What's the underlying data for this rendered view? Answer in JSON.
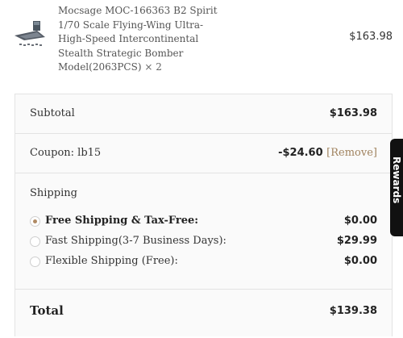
{
  "product": {
    "image_alt": "B2 stealth bomber model thumbnail",
    "title": "Mocsage MOC-166363 B2 Spirit 1/70 Scale Flying-Wing Ultra-High-Speed Intercontinental Stealth Strategic Bomber Model(2063PCS)",
    "quantity": "× 2",
    "price": "$163.98"
  },
  "summary": {
    "subtotal_label": "Subtotal",
    "subtotal_value": "$163.98",
    "coupon_label": "Coupon: lb15",
    "coupon_value": "-$24.60",
    "coupon_remove": "[Remove]",
    "shipping_label": "Shipping",
    "shipping_options": [
      {
        "label": "Free Shipping & Tax-Free:",
        "price": "$0.00",
        "selected": true
      },
      {
        "label": "Fast Shipping(3-7 Business Days):",
        "price": "$29.99",
        "selected": false
      },
      {
        "label": "Flexible Shipping (Free):",
        "price": "$0.00",
        "selected": false
      }
    ],
    "total_label": "Total",
    "total_value": "$139.38"
  },
  "side_tab": {
    "label": "Rewards"
  },
  "colors": {
    "accent": "#b08a64",
    "side_tab_bg": "#111111",
    "panel_bg": "#fafafa"
  }
}
